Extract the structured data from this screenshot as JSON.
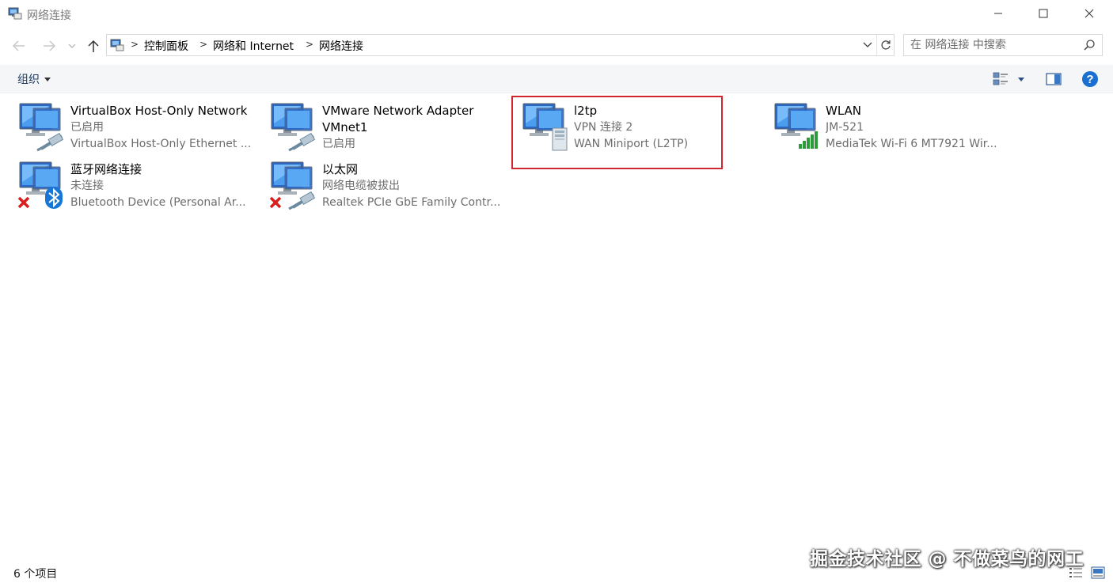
{
  "window": {
    "title": "网络连接",
    "min_glyph": "—",
    "max_glyph": "☐",
    "close_glyph": "✕"
  },
  "address": {
    "crumbs": [
      "控制面板",
      "网络和 Internet",
      "网络连接"
    ]
  },
  "search": {
    "placeholder": "在 网络连接 中搜索"
  },
  "toolbar": {
    "organize_label": "组织"
  },
  "items": [
    {
      "name": "VirtualBox Host-Only Network",
      "status": "已启用",
      "device": "VirtualBox Host-Only Ethernet ...",
      "badge": "ethernet-cable-icon"
    },
    {
      "name": "VMware Network Adapter",
      "status": "VMnet1",
      "device": "已启用",
      "badge": "ethernet-cable-icon"
    },
    {
      "name": "l2tp",
      "status": "VPN 连接 2",
      "device": "WAN Miniport (L2TP)",
      "badge": "server-tower-icon"
    },
    {
      "name": "WLAN",
      "status": "JM-521",
      "device": "MediaTek Wi-Fi 6 MT7921 Wir...",
      "badge": "wifi-signal-icon"
    },
    {
      "name": "蓝牙网络连接",
      "status": "未连接",
      "device": "Bluetooth Device (Personal Ar...",
      "badge": "bluetooth-icon"
    },
    {
      "name": "以太网",
      "status": "网络电缆被拔出",
      "device": "Realtek PCIe GbE Family Contr...",
      "badge": "ethernet-cable-icon"
    }
  ],
  "status_bar": {
    "item_count": "6 个项目"
  },
  "watermark": "掘金技术社区 @ 不做菜鸟的网工",
  "colors": {
    "highlight": "#d0262e",
    "link": "#1e3966",
    "help": "#1a6fd1",
    "disconnected": "#d81e1e"
  }
}
